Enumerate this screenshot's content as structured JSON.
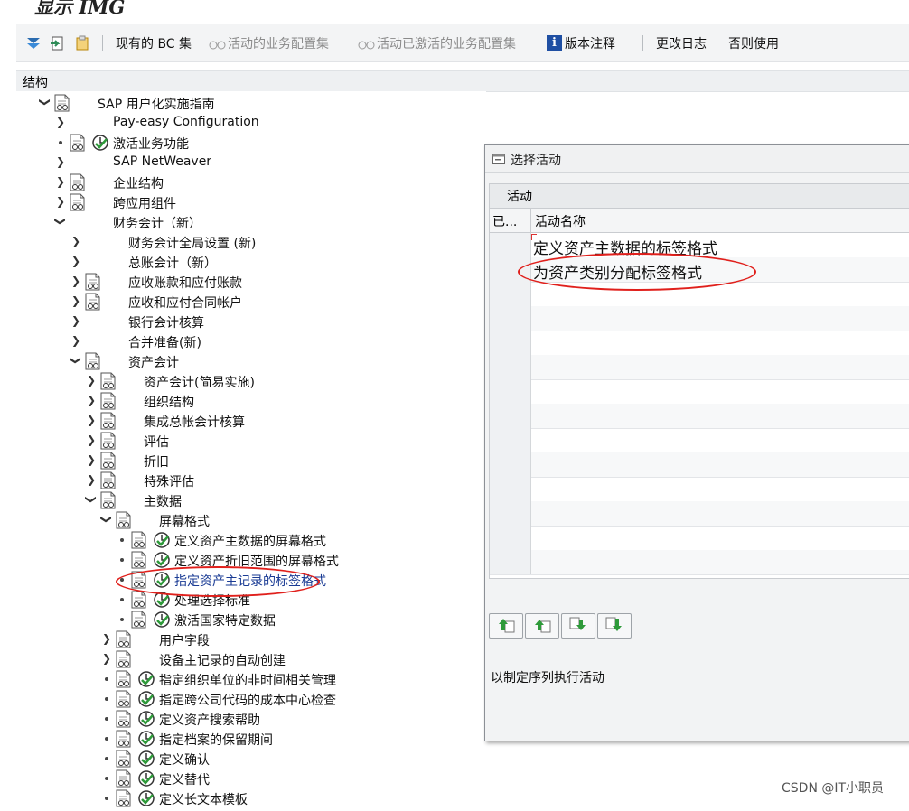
{
  "window": {
    "title": "显示 IMG"
  },
  "toolbar": {
    "bc_sets_label": "现有的 BC 集",
    "active_bc_label": "活动的业务配置集",
    "activated_bc_label": "活动已激活的业务配置集",
    "release_notes_label": "版本注释",
    "change_log_label": "更改日志",
    "otherwise_label": "否则使用"
  },
  "tree": {
    "header": "结构",
    "nodes": [
      {
        "label": "SAP 用户化实施指南"
      },
      {
        "label": "Pay-easy Configuration"
      },
      {
        "label": "激活业务功能"
      },
      {
        "label": "SAP NetWeaver"
      },
      {
        "label": "企业结构"
      },
      {
        "label": "跨应用组件"
      },
      {
        "label": "财务会计（新）"
      },
      {
        "label": "财务会计全局设置 (新)"
      },
      {
        "label": "总账会计（新）"
      },
      {
        "label": "应收账款和应付账款"
      },
      {
        "label": "应收和应付合同帐户"
      },
      {
        "label": "银行会计核算"
      },
      {
        "label": "合并准备(新)"
      },
      {
        "label": "资产会计"
      },
      {
        "label": "资产会计(简易实施)"
      },
      {
        "label": "组织结构"
      },
      {
        "label": "集成总帐会计核算"
      },
      {
        "label": "评估"
      },
      {
        "label": "折旧"
      },
      {
        "label": "特殊评估"
      },
      {
        "label": "主数据"
      },
      {
        "label": "屏幕格式"
      },
      {
        "label": "定义资产主数据的屏幕格式"
      },
      {
        "label": "定义资产折旧范围的屏幕格式"
      },
      {
        "label": "指定资产主记录的标签格式"
      },
      {
        "label": "处理选择标准"
      },
      {
        "label": "激活国家特定数据"
      },
      {
        "label": "用户字段"
      },
      {
        "label": "设备主记录的自动创建"
      },
      {
        "label": "指定组织单位的非时间相关管理"
      },
      {
        "label": "指定跨公司代码的成本中心检查"
      },
      {
        "label": "定义资产搜索帮助"
      },
      {
        "label": "指定档案的保留期间"
      },
      {
        "label": "定义确认"
      },
      {
        "label": "定义替代"
      },
      {
        "label": "定义长文本模板"
      }
    ]
  },
  "dialog": {
    "title": "选择活动",
    "grid_caption": "活动",
    "col_done": "已...",
    "col_name": "活动名称",
    "rows": [
      {
        "name": "定义资产主数据的标签格式"
      },
      {
        "name": "为资产类别分配标签格式"
      }
    ],
    "note": "以制定序列执行活动"
  },
  "watermark": "CSDN @IT小职员",
  "colors": {
    "annotation": "#e0201c",
    "selected_text": "#1a3b94"
  }
}
